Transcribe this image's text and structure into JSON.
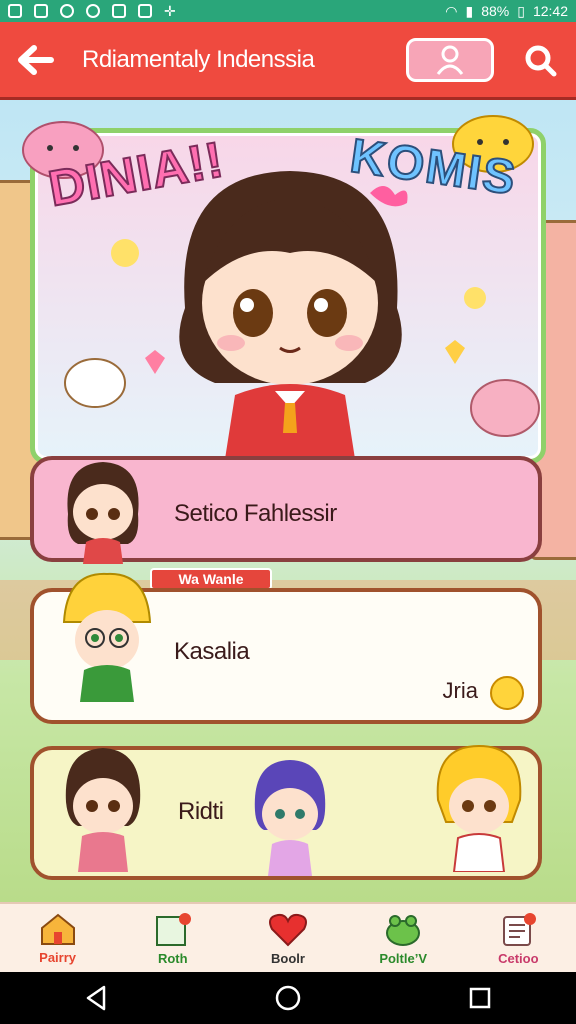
{
  "status_bar": {
    "battery": "88%",
    "time": "12:42"
  },
  "header": {
    "title": "Rdiamentaly Indenssia"
  },
  "hero": {
    "logo_left": "DINIA!!",
    "logo_right": "KOMIS"
  },
  "cards": [
    {
      "title": "Setico Fahlessir"
    },
    {
      "title": "Kasalia",
      "banner": "Wa Wanle",
      "tag": "Jria"
    },
    {
      "title": "Ridti"
    }
  ],
  "bottom_nav": [
    {
      "label": "Pairry",
      "icon": "home-icon",
      "color": "#e7452f"
    },
    {
      "label": "Roth",
      "icon": "book-icon",
      "color": "#2b8a2b"
    },
    {
      "label": "Boolr",
      "icon": "heart-icon",
      "color": "#333333"
    },
    {
      "label": "Poltle’V",
      "icon": "frog-icon",
      "color": "#2b8a2b"
    },
    {
      "label": "Cetioo",
      "icon": "list-icon",
      "color": "#c83a6a"
    }
  ],
  "colors": {
    "accent": "#ef4a3f",
    "status": "#2aa67a"
  }
}
